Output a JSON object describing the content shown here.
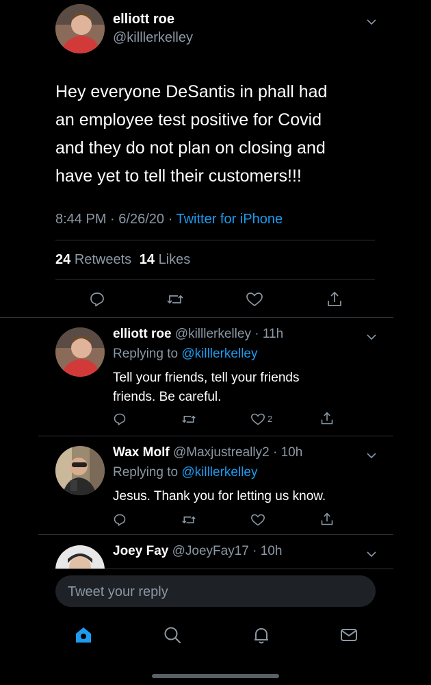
{
  "main_tweet": {
    "name": "elliott roe",
    "handle": "@killlerkelley",
    "text_lines": [
      "Hey everyone DeSantis in phall had",
      "an employee test positive for Covid",
      "and they do not plan on closing and",
      "have yet to tell their customers!!!"
    ],
    "time": "8:44 PM",
    "date": "6/26/20",
    "source": "Twitter for iPhone",
    "retweets_count": "24",
    "retweets_label": "Retweets",
    "likes_count": "14",
    "likes_label": "Likes"
  },
  "replies": [
    {
      "name": "elliott roe",
      "handle": "@killlerkelley",
      "age": "11h",
      "replying_label": "Replying to",
      "replying_to": "@killlerkelley",
      "text_lines": [
        "Tell your friends, tell your friends",
        "friends. Be careful."
      ],
      "like_count": "2"
    },
    {
      "name": "Wax Molf",
      "handle": "@Maxjustreally2",
      "age": "10h",
      "replying_label": "Replying to",
      "replying_to": "@killlerkelley",
      "text_lines": [
        "Jesus. Thank you for letting us know."
      ],
      "like_count": ""
    },
    {
      "name": "Joey Fay",
      "handle": "@JoeyFay17",
      "age": "10h"
    }
  ],
  "reply_box": {
    "placeholder": "Tweet your reply"
  },
  "bottom_nav": [
    "home-icon",
    "search-icon",
    "notifications-icon",
    "messages-icon"
  ],
  "colors": {
    "background": "#000000",
    "accent": "#1d9bf0",
    "muted": "#8b98a5",
    "divider": "#2f3336"
  }
}
